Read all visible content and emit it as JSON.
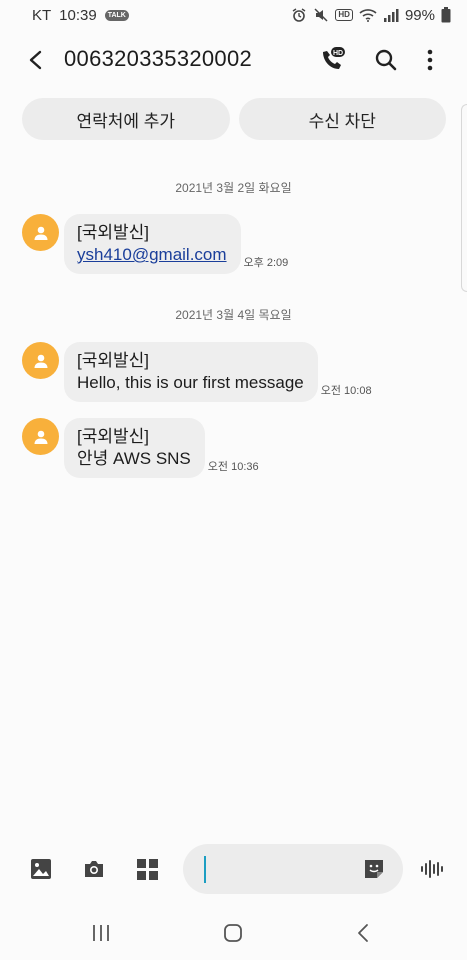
{
  "status_bar": {
    "carrier": "KT",
    "time": "10:39",
    "talk_badge": "TALK",
    "hd_badge": "HD",
    "battery": "99%",
    "icons": [
      "talk-icon",
      "alarm-icon",
      "mute-icon",
      "hd-icon",
      "wifi-icon",
      "signal-icon",
      "battery-icon"
    ]
  },
  "header": {
    "title": "006320335320002",
    "call_hd_badge": "HD",
    "icons": [
      "back-arrow-icon",
      "hd-call-icon",
      "search-icon",
      "more-vert-icon"
    ]
  },
  "actions": {
    "add_contact": "연락처에 추가",
    "block": "수신 차단"
  },
  "dates": [
    "2021년 3월 2일 화요일",
    "2021년 3월 4일 목요일"
  ],
  "messages": [
    {
      "line1": "[국외발신]",
      "link": "ysh410@gmail.com",
      "time": "오후 2:09"
    },
    {
      "line1": "[국외발신]",
      "line2": "Hello, this is our first message",
      "time": "오전 10:08"
    },
    {
      "line1": "[국외발신]",
      "line2": "안녕 AWS SNS",
      "time": "오전 10:36"
    }
  ],
  "composer": {
    "placeholder": "",
    "icons": [
      "gallery-icon",
      "camera-icon",
      "apps-grid-icon",
      "sticker-icon",
      "voice-icon"
    ]
  },
  "nav": {
    "icons": [
      "recent-apps-icon",
      "home-icon",
      "back-icon"
    ]
  },
  "colors": {
    "avatar": "#f8b03b",
    "bubble": "#eeeeee",
    "pill": "#ececec",
    "link": "#1a3e9a",
    "cursor": "#1c9ec2"
  }
}
